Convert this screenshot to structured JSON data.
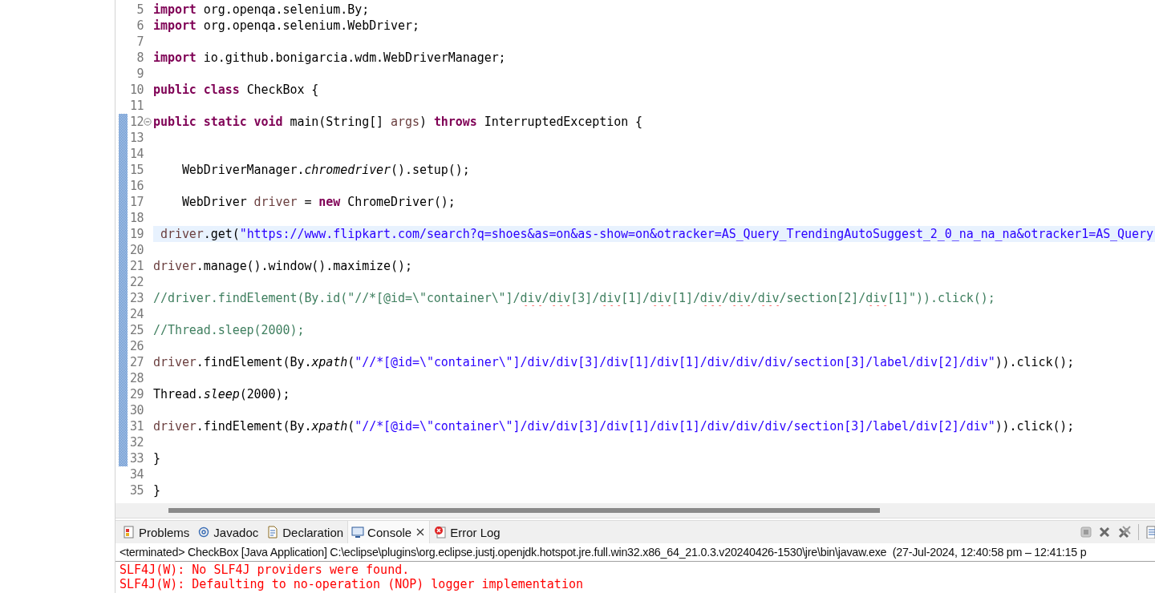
{
  "editor": {
    "lines": [
      {
        "number": "5",
        "current": false,
        "changed": false,
        "foldable": false,
        "tokens": [
          {
            "kind": "keyword",
            "text": "import"
          },
          {
            "kind": "plain",
            "text": " org.openqa.selenium.By;"
          }
        ]
      },
      {
        "number": "6",
        "current": false,
        "changed": false,
        "foldable": false,
        "tokens": [
          {
            "kind": "keyword",
            "text": "import"
          },
          {
            "kind": "plain",
            "text": " org.openqa.selenium.WebDriver;"
          }
        ]
      },
      {
        "number": "7",
        "current": false,
        "changed": false,
        "foldable": false
      },
      {
        "number": "8",
        "current": false,
        "changed": false,
        "foldable": false,
        "tokens": [
          {
            "kind": "keyword",
            "text": "import"
          },
          {
            "kind": "plain",
            "text": " io.github.bonigarcia.wdm.WebDriverManager;"
          }
        ]
      },
      {
        "number": "9",
        "current": false,
        "changed": false,
        "foldable": false
      },
      {
        "number": "10",
        "current": false,
        "changed": false,
        "foldable": false,
        "tokens": [
          {
            "kind": "keyword",
            "text": "public class"
          },
          {
            "kind": "plain",
            "text": " CheckBox {"
          }
        ]
      },
      {
        "number": "11",
        "current": false,
        "changed": false,
        "foldable": false
      },
      {
        "number": "12",
        "current": false,
        "changed": true,
        "foldable": true,
        "tokens": [
          {
            "kind": "keyword",
            "text": "public static void"
          },
          {
            "kind": "plain",
            "text": " main(String[] "
          },
          {
            "kind": "parameter",
            "text": "args"
          },
          {
            "kind": "plain",
            "text": ") "
          },
          {
            "kind": "keyword",
            "text": "throws"
          },
          {
            "kind": "plain",
            "text": " InterruptedException {"
          }
        ]
      },
      {
        "number": "13",
        "current": false,
        "changed": true,
        "foldable": false
      },
      {
        "number": "14",
        "current": false,
        "changed": true,
        "foldable": false
      },
      {
        "number": "15",
        "current": false,
        "changed": true,
        "foldable": false,
        "tokens": [
          {
            "kind": "plain",
            "text": "    WebDriverManager."
          },
          {
            "kind": "static",
            "text": "chromedriver"
          },
          {
            "kind": "plain",
            "text": "().setup();"
          }
        ]
      },
      {
        "number": "16",
        "current": false,
        "changed": true,
        "foldable": false
      },
      {
        "number": "17",
        "current": false,
        "changed": true,
        "foldable": false,
        "tokens": [
          {
            "kind": "plain",
            "text": "    WebDriver "
          },
          {
            "kind": "variable",
            "text": "driver"
          },
          {
            "kind": "plain",
            "text": " = "
          },
          {
            "kind": "keyword",
            "text": "new"
          },
          {
            "kind": "plain",
            "text": " ChromeDriver();"
          }
        ]
      },
      {
        "number": "18",
        "current": false,
        "changed": true,
        "foldable": false
      },
      {
        "number": "19",
        "current": true,
        "changed": true,
        "foldable": false,
        "tokens": [
          {
            "kind": "variable",
            "text": " driver"
          },
          {
            "kind": "plain",
            "text": ".get("
          },
          {
            "kind": "string",
            "text": "\"https://www.flipkart.com/search?q=shoes&as=on&as-show=on&otracker=AS_Query_TrendingAutoSuggest_2_0_na_na_na&otracker1=AS_Query"
          }
        ]
      },
      {
        "number": "20",
        "current": false,
        "changed": true,
        "foldable": false
      },
      {
        "number": "21",
        "current": false,
        "changed": true,
        "foldable": false,
        "tokens": [
          {
            "kind": "variable",
            "text": "driver"
          },
          {
            "kind": "plain",
            "text": ".manage().window().maximize();"
          }
        ]
      },
      {
        "number": "22",
        "current": false,
        "changed": true,
        "foldable": false
      },
      {
        "number": "23",
        "current": false,
        "changed": true,
        "foldable": false,
        "tokens": [
          {
            "kind": "comment",
            "text": "//driver.findElement(By.id(\"//*[@id=\\\"container\\\"]/"
          },
          {
            "kind": "flagged",
            "text": "div"
          },
          {
            "kind": "comment",
            "text": "/"
          },
          {
            "kind": "flagged",
            "text": "div"
          },
          {
            "kind": "comment",
            "text": "[3]/"
          },
          {
            "kind": "flagged",
            "text": "div"
          },
          {
            "kind": "comment",
            "text": "[1]/"
          },
          {
            "kind": "flagged",
            "text": "div"
          },
          {
            "kind": "comment",
            "text": "[1]/"
          },
          {
            "kind": "flagged",
            "text": "div"
          },
          {
            "kind": "comment",
            "text": "/"
          },
          {
            "kind": "flagged",
            "text": "div"
          },
          {
            "kind": "comment",
            "text": "/"
          },
          {
            "kind": "flagged",
            "text": "div"
          },
          {
            "kind": "comment",
            "text": "/section[2]/"
          },
          {
            "kind": "flagged",
            "text": "div"
          },
          {
            "kind": "comment",
            "text": "[1]\")).click();"
          }
        ]
      },
      {
        "number": "24",
        "current": false,
        "changed": true,
        "foldable": false
      },
      {
        "number": "25",
        "current": false,
        "changed": true,
        "foldable": false,
        "tokens": [
          {
            "kind": "comment",
            "text": "//Thread.sleep(2000);"
          }
        ]
      },
      {
        "number": "26",
        "current": false,
        "changed": true,
        "foldable": false
      },
      {
        "number": "27",
        "current": false,
        "changed": true,
        "foldable": false,
        "tokens": [
          {
            "kind": "variable",
            "text": "driver"
          },
          {
            "kind": "plain",
            "text": ".findElement(By."
          },
          {
            "kind": "static",
            "text": "xpath"
          },
          {
            "kind": "plain",
            "text": "("
          },
          {
            "kind": "string",
            "text": "\"//*[@id=\\\"container\\\"]/div/div[3]/div[1]/div[1]/div/div/div/section[3]/label/div[2]/div\""
          },
          {
            "kind": "plain",
            "text": ")).click();"
          }
        ]
      },
      {
        "number": "28",
        "current": false,
        "changed": true,
        "foldable": false
      },
      {
        "number": "29",
        "current": false,
        "changed": true,
        "foldable": false,
        "tokens": [
          {
            "kind": "plain",
            "text": "Thread."
          },
          {
            "kind": "static",
            "text": "sleep"
          },
          {
            "kind": "plain",
            "text": "(2000);"
          }
        ]
      },
      {
        "number": "30",
        "current": false,
        "changed": true,
        "foldable": false
      },
      {
        "number": "31",
        "current": false,
        "changed": true,
        "foldable": false,
        "tokens": [
          {
            "kind": "variable",
            "text": "driver"
          },
          {
            "kind": "plain",
            "text": ".findElement(By."
          },
          {
            "kind": "static",
            "text": "xpath"
          },
          {
            "kind": "plain",
            "text": "("
          },
          {
            "kind": "string",
            "text": "\"//*[@id=\\\"container\\\"]/div/div[3]/div[1]/div[1]/div/div/div/section[3]/label/div[2]/div\""
          },
          {
            "kind": "plain",
            "text": ")).click();"
          }
        ]
      },
      {
        "number": "32",
        "current": false,
        "changed": true,
        "foldable": false
      },
      {
        "number": "33",
        "current": false,
        "changed": true,
        "foldable": false,
        "tokens": [
          {
            "kind": "plain",
            "text": "}"
          }
        ]
      },
      {
        "number": "34",
        "current": false,
        "changed": false,
        "foldable": false
      },
      {
        "number": "35",
        "current": false,
        "changed": false,
        "foldable": false,
        "tokens": [
          {
            "kind": "plain",
            "text": "}"
          }
        ]
      }
    ]
  },
  "panel": {
    "tabs": [
      {
        "label": "Problems",
        "selected": false,
        "closable": false
      },
      {
        "label": "Javadoc",
        "selected": false,
        "closable": false
      },
      {
        "label": "Declaration",
        "selected": false,
        "closable": false
      },
      {
        "label": "Console",
        "selected": true,
        "closable": true
      },
      {
        "label": "Error Log",
        "selected": false,
        "closable": false
      }
    ],
    "status": "<terminated> CheckBox [Java Application] C:\\eclipse\\plugins\\org.eclipse.justj.openjdk.hotspot.jre.full.win32.x86_64_21.0.3.v20240426-1530\\jre\\bin\\javaw.exe  (27-Jul-2024, 12:40:58 pm – 12:41:15 p",
    "console": [
      "SLF4J(W): No SLF4J providers were found.",
      "SLF4J(W): Defaulting to no-operation (NOP) logger implementation"
    ]
  }
}
